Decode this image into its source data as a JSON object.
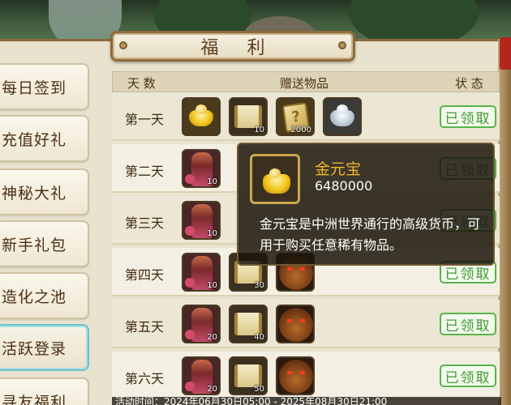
{
  "title": "福 利",
  "sidebar": {
    "items": [
      {
        "label": "每日签到"
      },
      {
        "label": "充值好礼"
      },
      {
        "label": "神秘大礼"
      },
      {
        "label": "新手礼包"
      },
      {
        "label": "造化之池"
      },
      {
        "label": "活跃登录"
      },
      {
        "label": "寻友福利"
      }
    ],
    "active_index": 5
  },
  "table": {
    "headers": {
      "day": "天 数",
      "gifts": "赠送物品",
      "status": "状 态"
    },
    "rows": [
      {
        "day": "第一天",
        "items": [
          {
            "icon": "gold-ingot-icon",
            "count": ""
          },
          {
            "icon": "scroll-icon",
            "count": "10"
          },
          {
            "icon": "mystery-card-icon",
            "count": "2000"
          },
          {
            "icon": "silver-ingot-icon",
            "count": ""
          }
        ],
        "status": "已领取"
      },
      {
        "day": "第二天",
        "items": [
          {
            "icon": "figure-icon",
            "count": "10"
          }
        ],
        "status": "已领取"
      },
      {
        "day": "第三天",
        "items": [
          {
            "icon": "figure-icon",
            "count": "10"
          }
        ],
        "status": "已领取"
      },
      {
        "day": "第四天",
        "items": [
          {
            "icon": "figure-icon",
            "count": "10"
          },
          {
            "icon": "scroll-icon",
            "count": "30"
          },
          {
            "icon": "bear-icon",
            "count": ""
          }
        ],
        "status": "已领取"
      },
      {
        "day": "第五天",
        "items": [
          {
            "icon": "figure-icon",
            "count": "20"
          },
          {
            "icon": "scroll-icon",
            "count": "40"
          },
          {
            "icon": "bear-icon",
            "count": ""
          }
        ],
        "status": "已领取"
      },
      {
        "day": "第六天",
        "items": [
          {
            "icon": "figure-icon",
            "count": "20"
          },
          {
            "icon": "scroll-icon",
            "count": "50"
          },
          {
            "icon": "bear-icon",
            "count": ""
          }
        ],
        "status": "已领取"
      }
    ]
  },
  "tooltip": {
    "name": "金元宝",
    "count": "6480000",
    "description": "金元宝是中洲世界通行的高级货币，可用于购买任意稀有物品。"
  },
  "footer": {
    "text": "活动时间：2024年06月30日05:00 - 2025年08月30日21:00"
  },
  "colors": {
    "claim_green": "#3e9a33",
    "tooltip_name": "#f0b52a",
    "active_border": "#6fc0c8"
  }
}
